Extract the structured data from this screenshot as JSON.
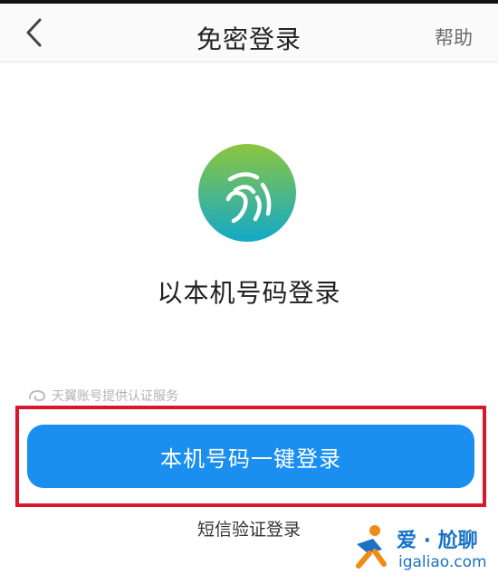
{
  "nav": {
    "title": "免密登录",
    "help_label": "帮助"
  },
  "main": {
    "title": "以本机号码登录",
    "provider_note": "天翼账号提供认证服务",
    "primary_button": "本机号码一键登录",
    "sms_login_link": "短信验证登录"
  },
  "watermark": {
    "brand": "爱 · 尬聊",
    "url": "igaliao.com"
  },
  "icons": {
    "back": "chevron-left-icon",
    "logo": "fingerprint-logo-icon",
    "provider": "tianyi-logo-icon",
    "watermark": "runner-logo-icon"
  },
  "colors": {
    "primary": "#1a8ff0",
    "highlight": "#d9172a",
    "logo_top": "#8cc63f",
    "logo_bottom": "#12a9c9"
  }
}
